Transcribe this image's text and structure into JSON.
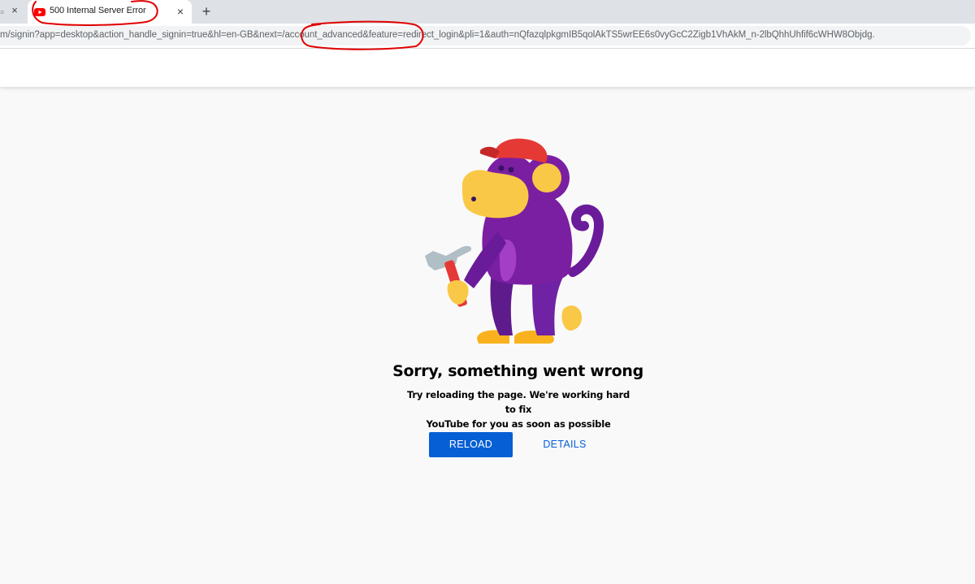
{
  "browser": {
    "prev_tab_close": "×",
    "active_tab": {
      "title": "500 Internal Server Error",
      "favicon": "youtube-icon",
      "close": "×"
    },
    "new_tab": "+",
    "url": "m/signin?app=desktop&action_handle_signin=true&hl=en-GB&next=/account_advanced&feature=redirect_login&pli=1&auth=nQfazqlpkgmIB5qolAkTS5wrEE6s0vyGcC2Zigb1VhAkM_n-2lbQhhUhfif6cWHW8Objdg."
  },
  "error": {
    "illustration": "monkey-with-hammer-icon",
    "heading": "Sorry, something went wrong",
    "message_line1": "Try reloading the page. We're working hard to fix",
    "message_line2": "YouTube for you as soon as possible",
    "reload_label": "RELOAD",
    "details_label": "DETAILS"
  },
  "colors": {
    "accent": "#065fd4",
    "annotation": "#e00000",
    "background": "#f9f9f9"
  }
}
